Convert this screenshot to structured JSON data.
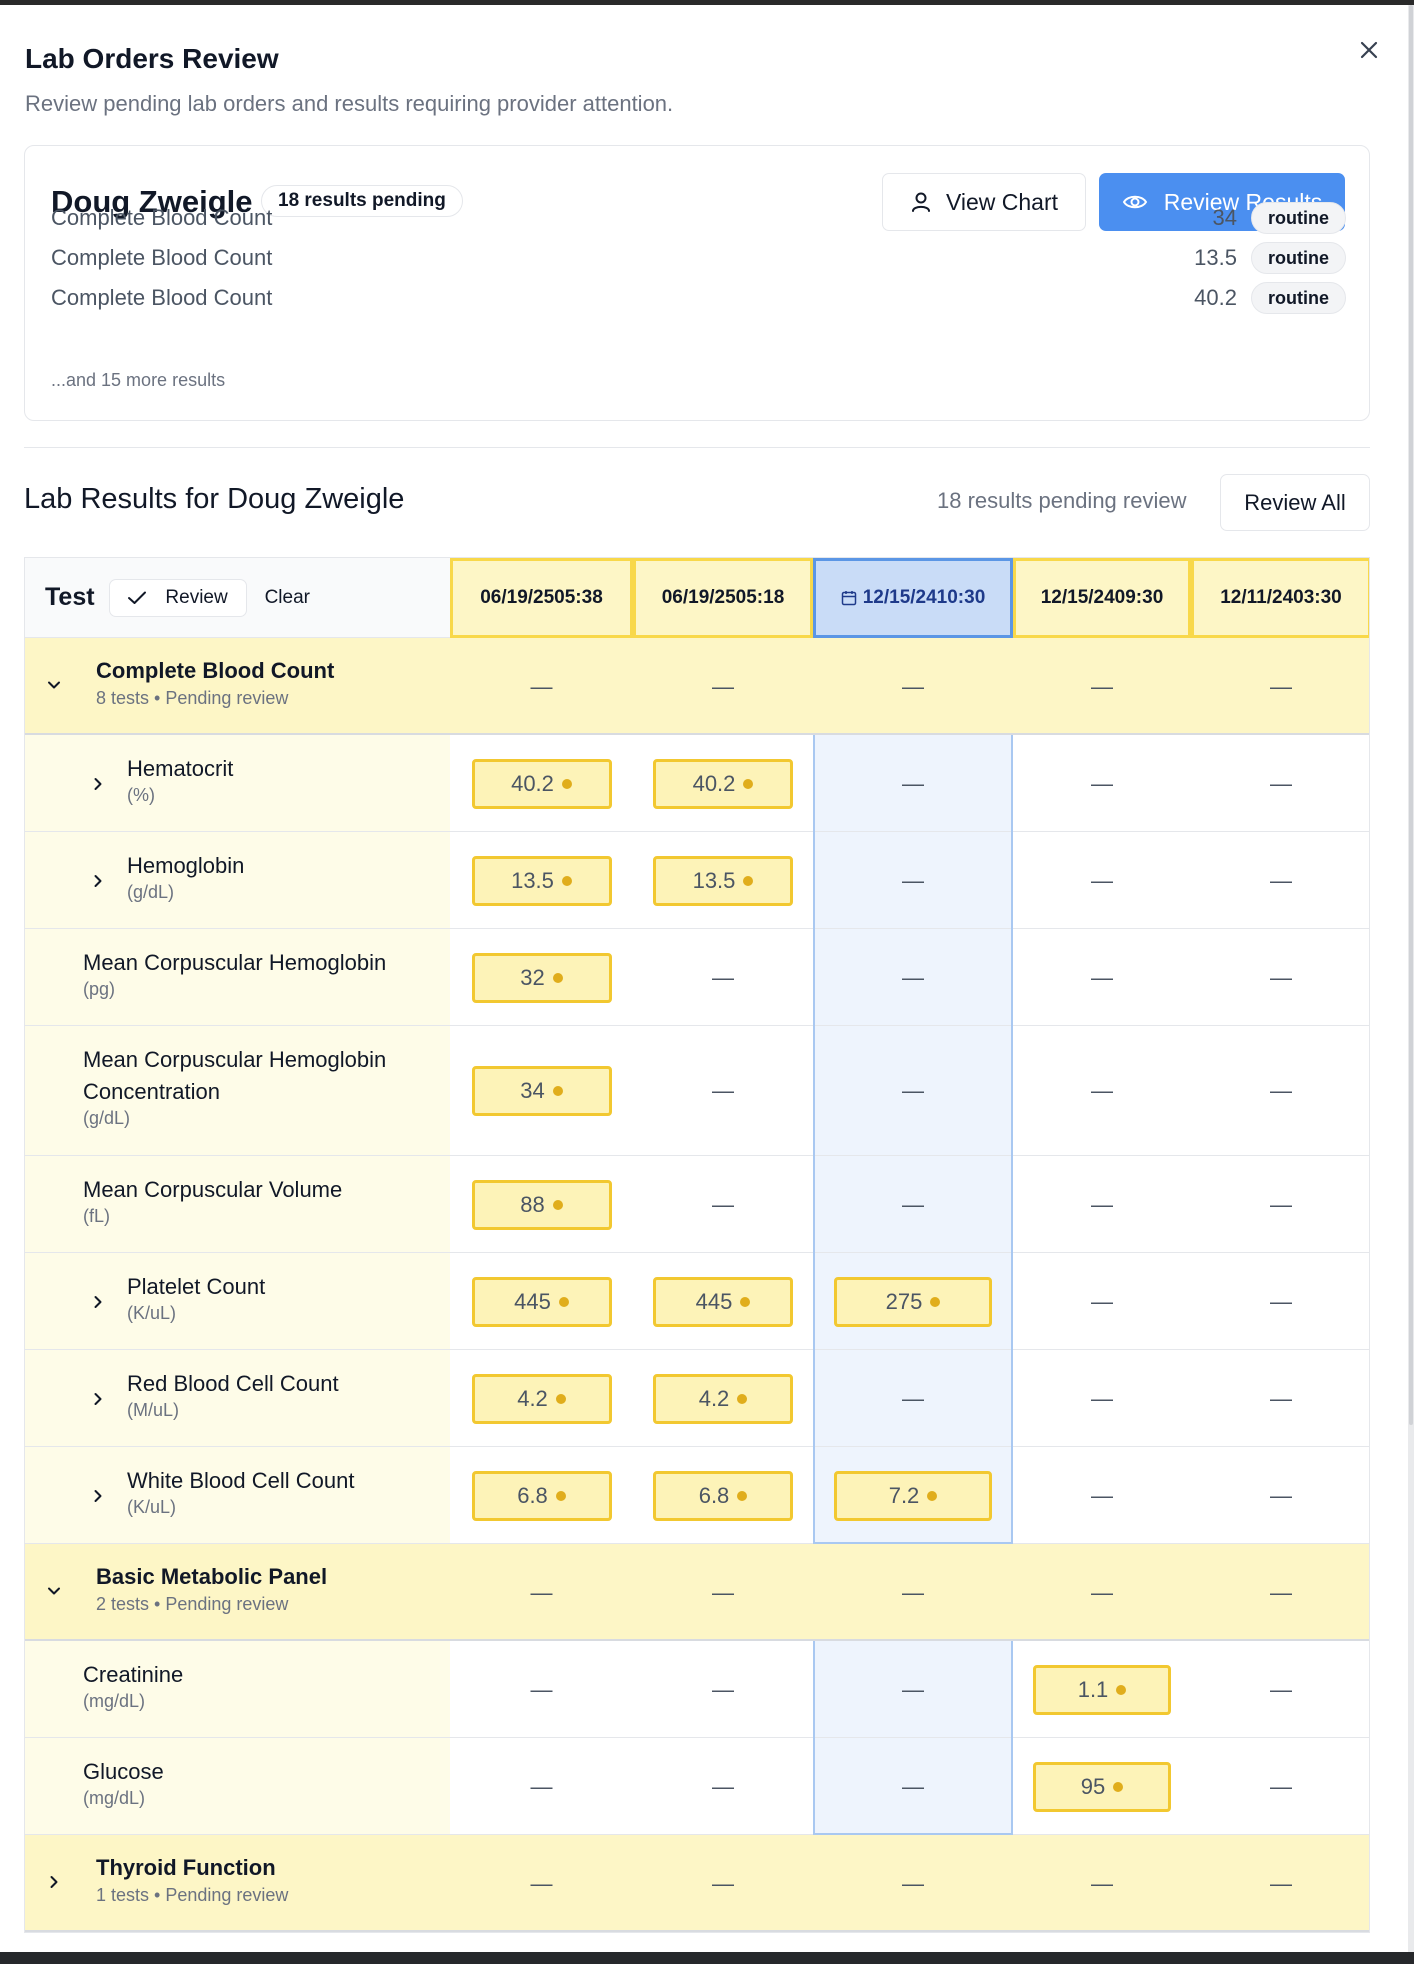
{
  "dialog": {
    "title": "Lab Orders Review",
    "subtitle": "Review pending lab orders and results requiring provider attention."
  },
  "summary": {
    "patient_name": "Doug Zweigle",
    "pending_badge": "18 results pending",
    "view_chart_label": "View Chart",
    "review_results_label": "Review Results",
    "rows": [
      {
        "name": "Complete Blood Count",
        "value": "34",
        "priority": "routine"
      },
      {
        "name": "Complete Blood Count",
        "value": "13.5",
        "priority": "routine"
      },
      {
        "name": "Complete Blood Count",
        "value": "40.2",
        "priority": "routine"
      }
    ],
    "more_text": "...and 15 more results"
  },
  "results": {
    "section_title": "Lab Results for Doug Zweigle",
    "pending_text": "18 results pending review",
    "review_all_label": "Review All",
    "test_header": "Test",
    "review_label": "Review",
    "clear_label": "Clear",
    "dates": [
      "06/19/2505:38",
      "06/19/2505:18",
      "12/15/2410:30",
      "12/15/2409:30",
      "12/11/2403:30"
    ],
    "selected_date_index": 2,
    "empty_mark": "—",
    "groups": [
      {
        "name": "Complete Blood Count",
        "summary": "8 tests • Pending review",
        "expanded": true,
        "tests": [
          {
            "name": "Hematocrit",
            "unit": "(%)",
            "expandable": true,
            "values": [
              "40.2",
              "40.2",
              null,
              null,
              null
            ]
          },
          {
            "name": "Hemoglobin",
            "unit": "(g/dL)",
            "expandable": true,
            "values": [
              "13.5",
              "13.5",
              null,
              null,
              null
            ]
          },
          {
            "name": "Mean Corpuscular Hemoglobin",
            "unit": "(pg)",
            "expandable": false,
            "values": [
              "32",
              null,
              null,
              null,
              null
            ]
          },
          {
            "name_line1": "Mean Corpuscular Hemoglobin",
            "name_line2": "Concentration",
            "unit": "(g/dL)",
            "expandable": false,
            "values": [
              "34",
              null,
              null,
              null,
              null
            ]
          },
          {
            "name": "Mean Corpuscular Volume",
            "unit": "(fL)",
            "expandable": false,
            "values": [
              "88",
              null,
              null,
              null,
              null
            ]
          },
          {
            "name": "Platelet Count",
            "unit": "(K/uL)",
            "expandable": true,
            "values": [
              "445",
              "445",
              "275",
              null,
              null
            ]
          },
          {
            "name": "Red Blood Cell Count",
            "unit": "(M/uL)",
            "expandable": true,
            "values": [
              "4.2",
              "4.2",
              null,
              null,
              null
            ]
          },
          {
            "name": "White Blood Cell Count",
            "unit": "(K/uL)",
            "expandable": true,
            "values": [
              "6.8",
              "6.8",
              "7.2",
              null,
              null
            ]
          }
        ]
      },
      {
        "name": "Basic Metabolic Panel",
        "summary": "2 tests • Pending review",
        "expanded": true,
        "tests": [
          {
            "name": "Creatinine",
            "unit": "(mg/dL)",
            "expandable": false,
            "values": [
              null,
              null,
              null,
              "1.1",
              null
            ]
          },
          {
            "name": "Glucose",
            "unit": "(mg/dL)",
            "expandable": false,
            "values": [
              null,
              null,
              null,
              "95",
              null
            ]
          }
        ]
      },
      {
        "name": "Thyroid Function",
        "summary": "1 tests • Pending review",
        "expanded": false,
        "tests": []
      }
    ]
  },
  "colors": {
    "accent": "#4b8ff0",
    "pending_fill": "#fdf3b8",
    "pending_border": "#f2c830",
    "selected_column": "#c9dcf7"
  }
}
